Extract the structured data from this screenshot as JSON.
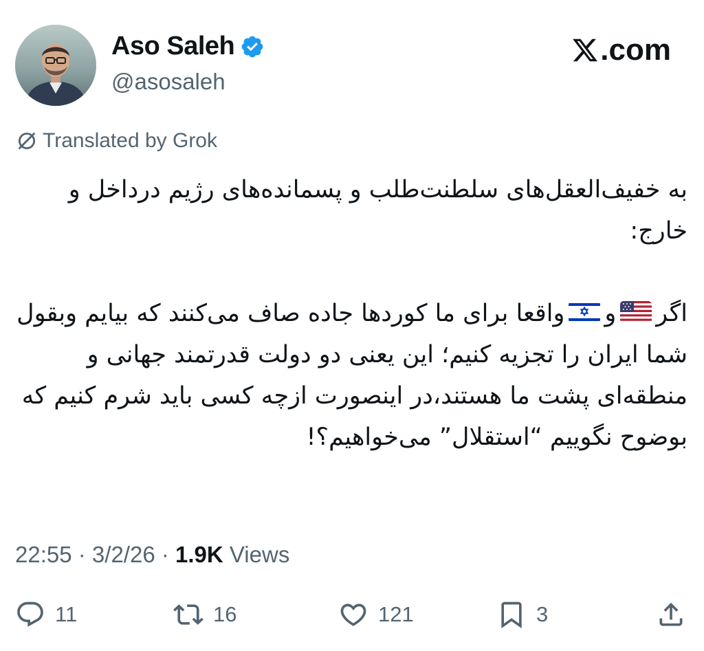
{
  "author": {
    "display_name": "Aso Saleh",
    "handle": "@asosaleh",
    "verified_color": "#1d9bf0"
  },
  "brand": {
    "text": ".com",
    "icon": "x-logo-icon"
  },
  "translation_note": "Translated by Grok",
  "tweet": {
    "line1": "به خفیف‌العقل‌های سلطنت‌طلب و پسمانده‌های رژیم درداخل و خارج:",
    "line2_start": "اگر",
    "line2_and": "و",
    "line2_rest": "واقعا برای ما کوردها جاده صاف می‌کنند که بیایم وبقول شما ایران را تجزیه کنیم؛ این یعنی دو دولت قدرتمند جهانی و منطقه‌ای پشت ما هستند،در اینصورت ازچه کسی باید شرم کنیم که بوضوح نگوییم “استقلال” می‌خواهیم؟!",
    "flag_1": "us-flag-icon",
    "flag_2": "israel-flag-icon"
  },
  "meta": {
    "time": "22:55",
    "sep1": " · ",
    "date": "3/2/26",
    "sep2": " · ",
    "views_count": "1.9K",
    "views_label": " Views"
  },
  "actions": {
    "replies": "11",
    "reposts": "16",
    "likes": "121",
    "bookmarks": "3"
  }
}
